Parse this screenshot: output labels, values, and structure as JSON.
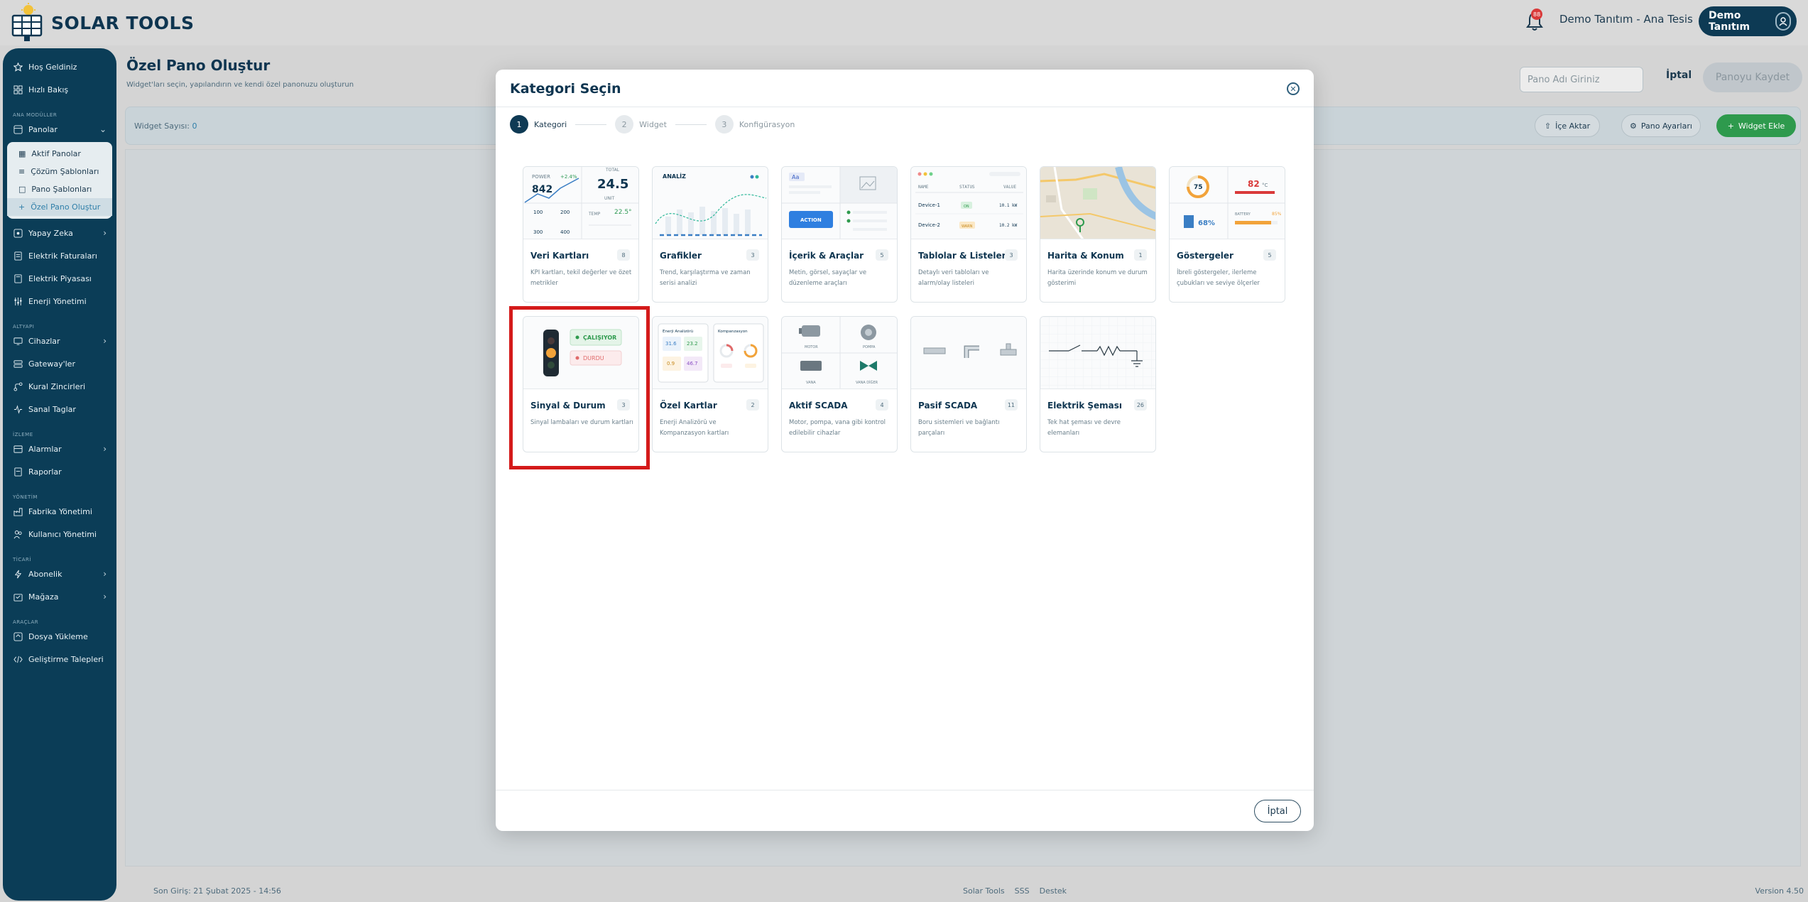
{
  "header": {
    "logo_text": "SOLAR TOOLS",
    "notification_count": "88",
    "tenant": "Demo Tanıtım - Ana Tesis",
    "user": "Demo Tanıtım"
  },
  "sidebar": {
    "top_items": [
      {
        "label": "Hoş Geldiniz",
        "icon": "star-icon"
      },
      {
        "label": "Hızlı Bakış",
        "icon": "grid-icon"
      }
    ],
    "section_main": "ANA MODÜLLER",
    "panolar": "Panolar",
    "panolar_sub": [
      {
        "label": "Aktif Panolar"
      },
      {
        "label": "Çözüm Şablonları"
      },
      {
        "label": "Pano Şablonları"
      },
      {
        "label": "Özel Pano Oluştur"
      }
    ],
    "main_items": [
      {
        "label": "Yapay Zeka"
      },
      {
        "label": "Elektrik Faturaları"
      },
      {
        "label": "Elektrik Piyasası"
      },
      {
        "label": "Enerji Yönetimi"
      }
    ],
    "section_altyapi": "ALTYAPI",
    "altyapi_items": [
      {
        "label": "Cihazlar"
      },
      {
        "label": "Gateway'ler"
      },
      {
        "label": "Kural Zincirleri"
      },
      {
        "label": "Sanal Taglar"
      }
    ],
    "section_izleme": "İZLEME",
    "izleme_items": [
      {
        "label": "Alarmlar"
      },
      {
        "label": "Raporlar"
      }
    ],
    "section_yonetim": "YÖNETİM",
    "yonetim_items": [
      {
        "label": "Fabrika Yönetimi"
      },
      {
        "label": "Kullanıcı Yönetimi"
      }
    ],
    "section_ticari": "TİCARİ",
    "ticari_items": [
      {
        "label": "Abonelik"
      },
      {
        "label": "Mağaza"
      }
    ],
    "section_araclar": "ARAÇLAR",
    "araclar_items": [
      {
        "label": "Dosya Yükleme"
      },
      {
        "label": "Geliştirme Talepleri"
      }
    ]
  },
  "page": {
    "title": "Özel Pano Oluştur",
    "subtitle": "Widget'ları seçin, yapılandırın ve kendi özel panonuzu oluşturun",
    "name_placeholder": "Pano Adı Giriniz",
    "cancel": "İptal",
    "save": "Panoyu Kaydet",
    "widget_count_label": "Widget Sayısı:",
    "widget_count": "0",
    "import": "İçe Aktar",
    "settings": "Pano Ayarları",
    "add_widget": "Widget Ekle"
  },
  "footer": {
    "last_login": "Son Giriş: 21 Şubat 2025 - 14:56",
    "links": [
      "Solar Tools",
      "SSS",
      "Destek"
    ],
    "version": "Version 4.50"
  },
  "modal": {
    "title": "Kategori Seçin",
    "steps": [
      {
        "num": "1",
        "label": "Kategori"
      },
      {
        "num": "2",
        "label": "Widget"
      },
      {
        "num": "3",
        "label": "Konfigürasyon"
      }
    ],
    "cancel": "İptal",
    "cards": [
      {
        "name": "Veri Kartları",
        "count": "8",
        "desc": "KPI kartları, tekil değerler ve özet metrikler"
      },
      {
        "name": "Grafikler",
        "count": "3",
        "desc": "Trend, karşılaştırma ve zaman serisi analizi"
      },
      {
        "name": "İçerik & Araçlar",
        "count": "5",
        "desc": "Metin, görsel, sayaçlar ve düzenleme araçları"
      },
      {
        "name": "Tablolar & Listeler",
        "count": "3",
        "desc": "Detaylı veri tabloları ve alarm/olay listeleri"
      },
      {
        "name": "Harita & Konum",
        "count": "1",
        "desc": "Harita üzerinde konum ve durum gösterimi"
      },
      {
        "name": "Göstergeler",
        "count": "5",
        "desc": "İbreli göstergeler, ilerleme çubukları ve seviye ölçerler"
      },
      {
        "name": "Sinyal & Durum",
        "count": "3",
        "desc": "Sinyal lambaları ve durum kartları"
      },
      {
        "name": "Özel Kartlar",
        "count": "2",
        "desc": "Enerji Analizörü ve Kompanzasyon kartları"
      },
      {
        "name": "Aktif SCADA",
        "count": "4",
        "desc": "Motor, pompa, vana gibi kontrol edilebilir cihazlar"
      },
      {
        "name": "Pasif SCADA",
        "count": "11",
        "desc": "Boru sistemleri ve bağlantı parçaları"
      },
      {
        "name": "Elektrik Şeması",
        "count": "26",
        "desc": "Tek hat şeması ve devre elemanları"
      }
    ],
    "preview": {
      "veri": {
        "power": "POWER",
        "power_val": "842",
        "delta": "+2.4%",
        "total": "TOTAL",
        "total_val": "24.5",
        "unit": "UNIT",
        "temp": "TEMP",
        "temp_val": "22.5°",
        "r1": [
          "100",
          "200"
        ],
        "r2": [
          "300",
          "400"
        ]
      },
      "grafik": {
        "title": "ANALİZ"
      },
      "icerik": {
        "aa": "Aa",
        "action": "ACTION"
      },
      "tablo": {
        "headers": [
          "NAME",
          "STATUS",
          "VALUE"
        ],
        "rows": [
          [
            "Device-1",
            "ON",
            "10.1 kW"
          ],
          [
            "Device-2",
            "WARN",
            "10.2 kW"
          ]
        ]
      },
      "gosterge": {
        "gauge": "75",
        "temp": "82",
        "unit": "°C",
        "tank": "68%",
        "bat": "BATTERY",
        "bat_val": "85%"
      },
      "sinyal": {
        "running": "ÇALIŞIYOR",
        "stopped": "DURDU"
      },
      "ozel": {
        "t1": "Enerji Analizörü",
        "t2": "Kompanzasyon",
        "v": [
          "31.6",
          "23.2",
          "0.9",
          "46.7"
        ]
      },
      "scada": {
        "labels": [
          "MOTOR",
          "POMPA",
          "VANA",
          "VANA DİĞER"
        ]
      }
    }
  },
  "colors": {
    "primary": "#0b3d57",
    "accent_green": "#2e9a4d",
    "highlight_red": "#d41a1a"
  }
}
